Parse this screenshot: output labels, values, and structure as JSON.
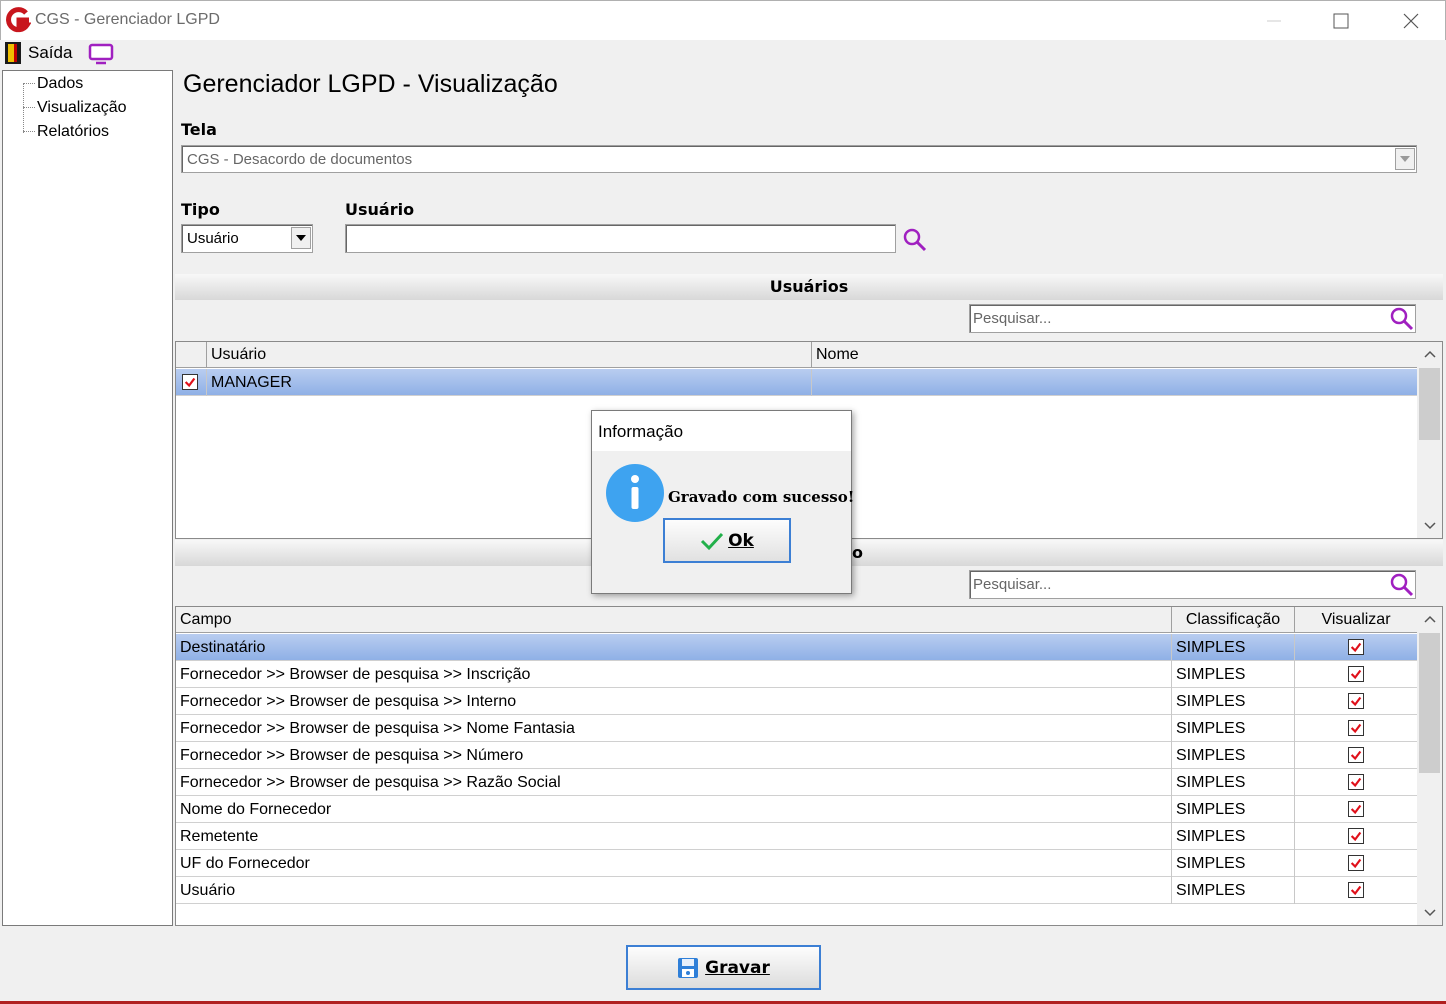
{
  "window": {
    "title": "CGS - Gerenciador LGPD"
  },
  "menu": {
    "exit_label": "Saída"
  },
  "tree": {
    "items": [
      "Dados",
      "Visualização",
      "Relatórios"
    ]
  },
  "main": {
    "title": "Gerenciador LGPD - Visualização",
    "tela_label": "Tela",
    "tela_value": "CGS - Desacordo de documentos",
    "tipo_label": "Tipo",
    "tipo_value": "Usuário",
    "usuario_label": "Usuário",
    "usuario_value": ""
  },
  "users_section": {
    "header": "Usuários",
    "search_placeholder": "Pesquisar...",
    "columns": [
      "Usuário",
      "Nome"
    ],
    "rows": [
      {
        "checked": true,
        "usuario": "MANAGER",
        "nome": ""
      }
    ]
  },
  "fields_section": {
    "header_visible_suffix": "o",
    "search_placeholder": "Pesquisar...",
    "columns": [
      "Campo",
      "Classificação",
      "Visualizar"
    ],
    "rows": [
      {
        "campo": "Destinatário",
        "classificacao": "SIMPLES",
        "visualizar": true
      },
      {
        "campo": "Fornecedor >> Browser de pesquisa >> Inscrição",
        "classificacao": "SIMPLES",
        "visualizar": true
      },
      {
        "campo": "Fornecedor >> Browser de pesquisa >> Interno",
        "classificacao": "SIMPLES",
        "visualizar": true
      },
      {
        "campo": "Fornecedor >> Browser de pesquisa >> Nome Fantasia",
        "classificacao": "SIMPLES",
        "visualizar": true
      },
      {
        "campo": "Fornecedor >> Browser de pesquisa >> Número",
        "classificacao": "SIMPLES",
        "visualizar": true
      },
      {
        "campo": "Fornecedor >> Browser de pesquisa >> Razão Social",
        "classificacao": "SIMPLES",
        "visualizar": true
      },
      {
        "campo": "Nome do Fornecedor",
        "classificacao": "SIMPLES",
        "visualizar": true
      },
      {
        "campo": "Remetente",
        "classificacao": "SIMPLES",
        "visualizar": true
      },
      {
        "campo": "UF do Fornecedor",
        "classificacao": "SIMPLES",
        "visualizar": true
      },
      {
        "campo": "Usuário",
        "classificacao": "SIMPLES",
        "visualizar": true
      }
    ]
  },
  "dialog": {
    "title": "Informação",
    "message": "Gravado com sucesso!",
    "ok_label": "Ok"
  },
  "footer": {
    "save_label": "Gravar"
  },
  "colors": {
    "accent": "#3c7fd4",
    "selection": "#9fbaea",
    "check": "#e0101a",
    "search_icon": "#a020c0"
  }
}
